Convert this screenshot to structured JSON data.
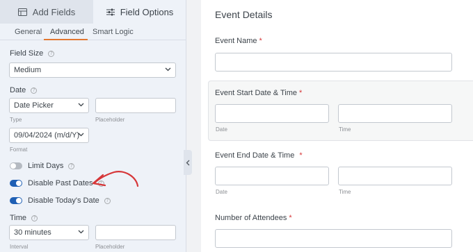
{
  "sidebar": {
    "tabs": [
      {
        "label": "Add Fields",
        "icon": "table-icon"
      },
      {
        "label": "Field Options",
        "icon": "sliders-icon"
      }
    ],
    "subtabs": [
      "General",
      "Advanced",
      "Smart Logic"
    ],
    "field_size": {
      "label": "Field Size",
      "value": "Medium"
    },
    "date": {
      "label": "Date",
      "type_value": "Date Picker",
      "type_sublabel": "Type",
      "placeholder_sublabel": "Placeholder",
      "format_value": "09/04/2024 (m/d/Y)",
      "format_sublabel": "Format"
    },
    "toggles": [
      {
        "label": "Limit Days",
        "on": false
      },
      {
        "label": "Disable Past Dates",
        "on": true
      },
      {
        "label": "Disable Today's Date",
        "on": true
      }
    ],
    "time": {
      "label": "Time",
      "interval_value": "30 minutes",
      "interval_sublabel": "Interval",
      "placeholder_sublabel": "Placeholder"
    }
  },
  "form": {
    "title": "Event Details",
    "fields": [
      {
        "label": "Event Name",
        "required": "*"
      },
      {
        "label": "Event Start Date & Time",
        "required": "*",
        "sub": [
          "Date",
          "Time"
        ]
      },
      {
        "label": "Event End Date & Time",
        "required": "*",
        "sub": [
          "Date",
          "Time"
        ]
      },
      {
        "label": "Number of Attendees",
        "required": "*"
      }
    ]
  },
  "colors": {
    "accent": "#e27730",
    "toggle_on": "#1e5fb4",
    "required": "#d63638",
    "annotation": "#d63638"
  }
}
